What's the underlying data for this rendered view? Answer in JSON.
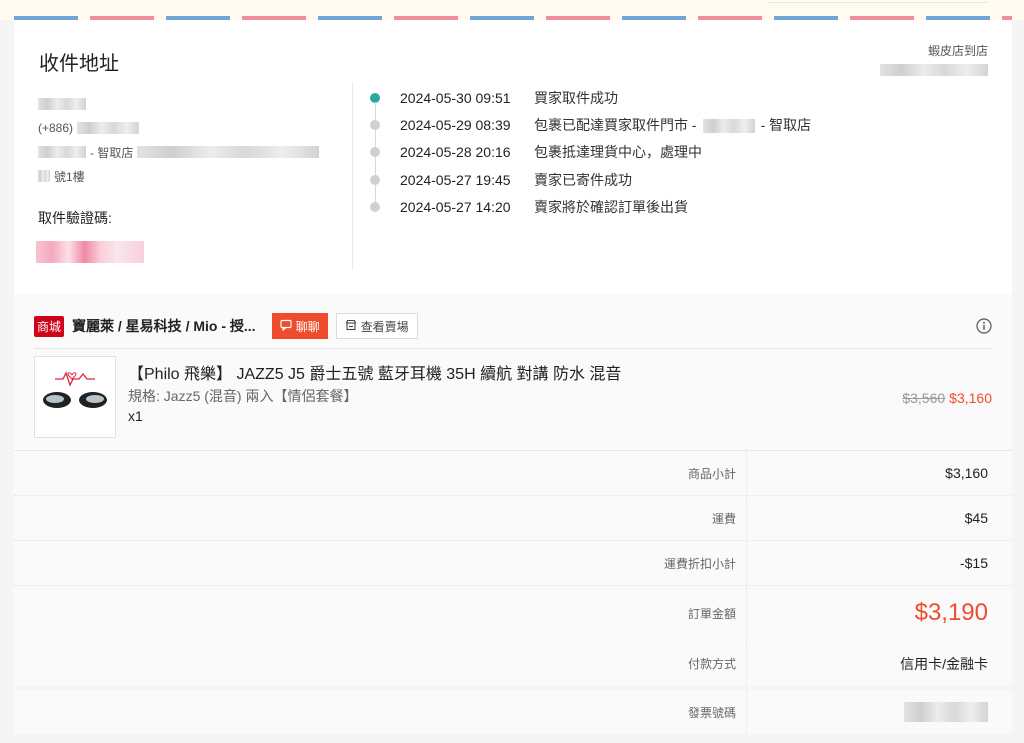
{
  "address": {
    "title": "收件地址",
    "phone_prefix": "(+886)",
    "store_suffix": "- 智取店",
    "floor_suffix": "號1樓",
    "verify_label": "取件驗證碼:"
  },
  "logistics": {
    "carrier": "蝦皮店到店"
  },
  "timeline": [
    {
      "time": "2024-05-30 09:51",
      "desc_a": "買家取件成功",
      "desc_b": "",
      "active": true
    },
    {
      "time": "2024-05-29 08:39",
      "desc_a": "包裹已配達買家取件門市 -",
      "desc_b": "- 智取店",
      "active": false
    },
    {
      "time": "2024-05-28 20:16",
      "desc_a": "包裹抵達理貨中心，處理中",
      "desc_b": "",
      "active": false
    },
    {
      "time": "2024-05-27 19:45",
      "desc_a": "賣家已寄件成功",
      "desc_b": "",
      "active": false
    },
    {
      "time": "2024-05-27 14:20",
      "desc_a": "賣家將於確認訂單後出貨",
      "desc_b": "",
      "active": false
    }
  ],
  "shop": {
    "badge": "商城",
    "name": "寶麗萊 / 星易科技 / Mio - 授...",
    "chat_label": "聊聊",
    "view_shop_label": "查看賣場"
  },
  "product": {
    "name": "【Philo 飛樂】 JAZZ5 J5 爵士五號 藍牙耳機 35H 續航 對講 防水 混音",
    "variant": "規格: Jazz5 (混音) 兩入【情侶套餐】",
    "qty": "x1",
    "original_price": "$3,560",
    "price": "$3,160"
  },
  "summary": {
    "subtotal_label": "商品小計",
    "subtotal": "$3,160",
    "shipping_label": "運費",
    "shipping": "$45",
    "shipping_discount_label": "運費折扣小計",
    "shipping_discount": "-$15",
    "total_label": "訂單金額",
    "total": "$3,190",
    "payment_label": "付款方式",
    "payment": "信用卡/金融卡",
    "invoice_label": "發票號碼"
  },
  "colors": {
    "accent": "#ee4d2d",
    "mall_red": "#d0011b",
    "timeline_active": "#26aa99"
  }
}
